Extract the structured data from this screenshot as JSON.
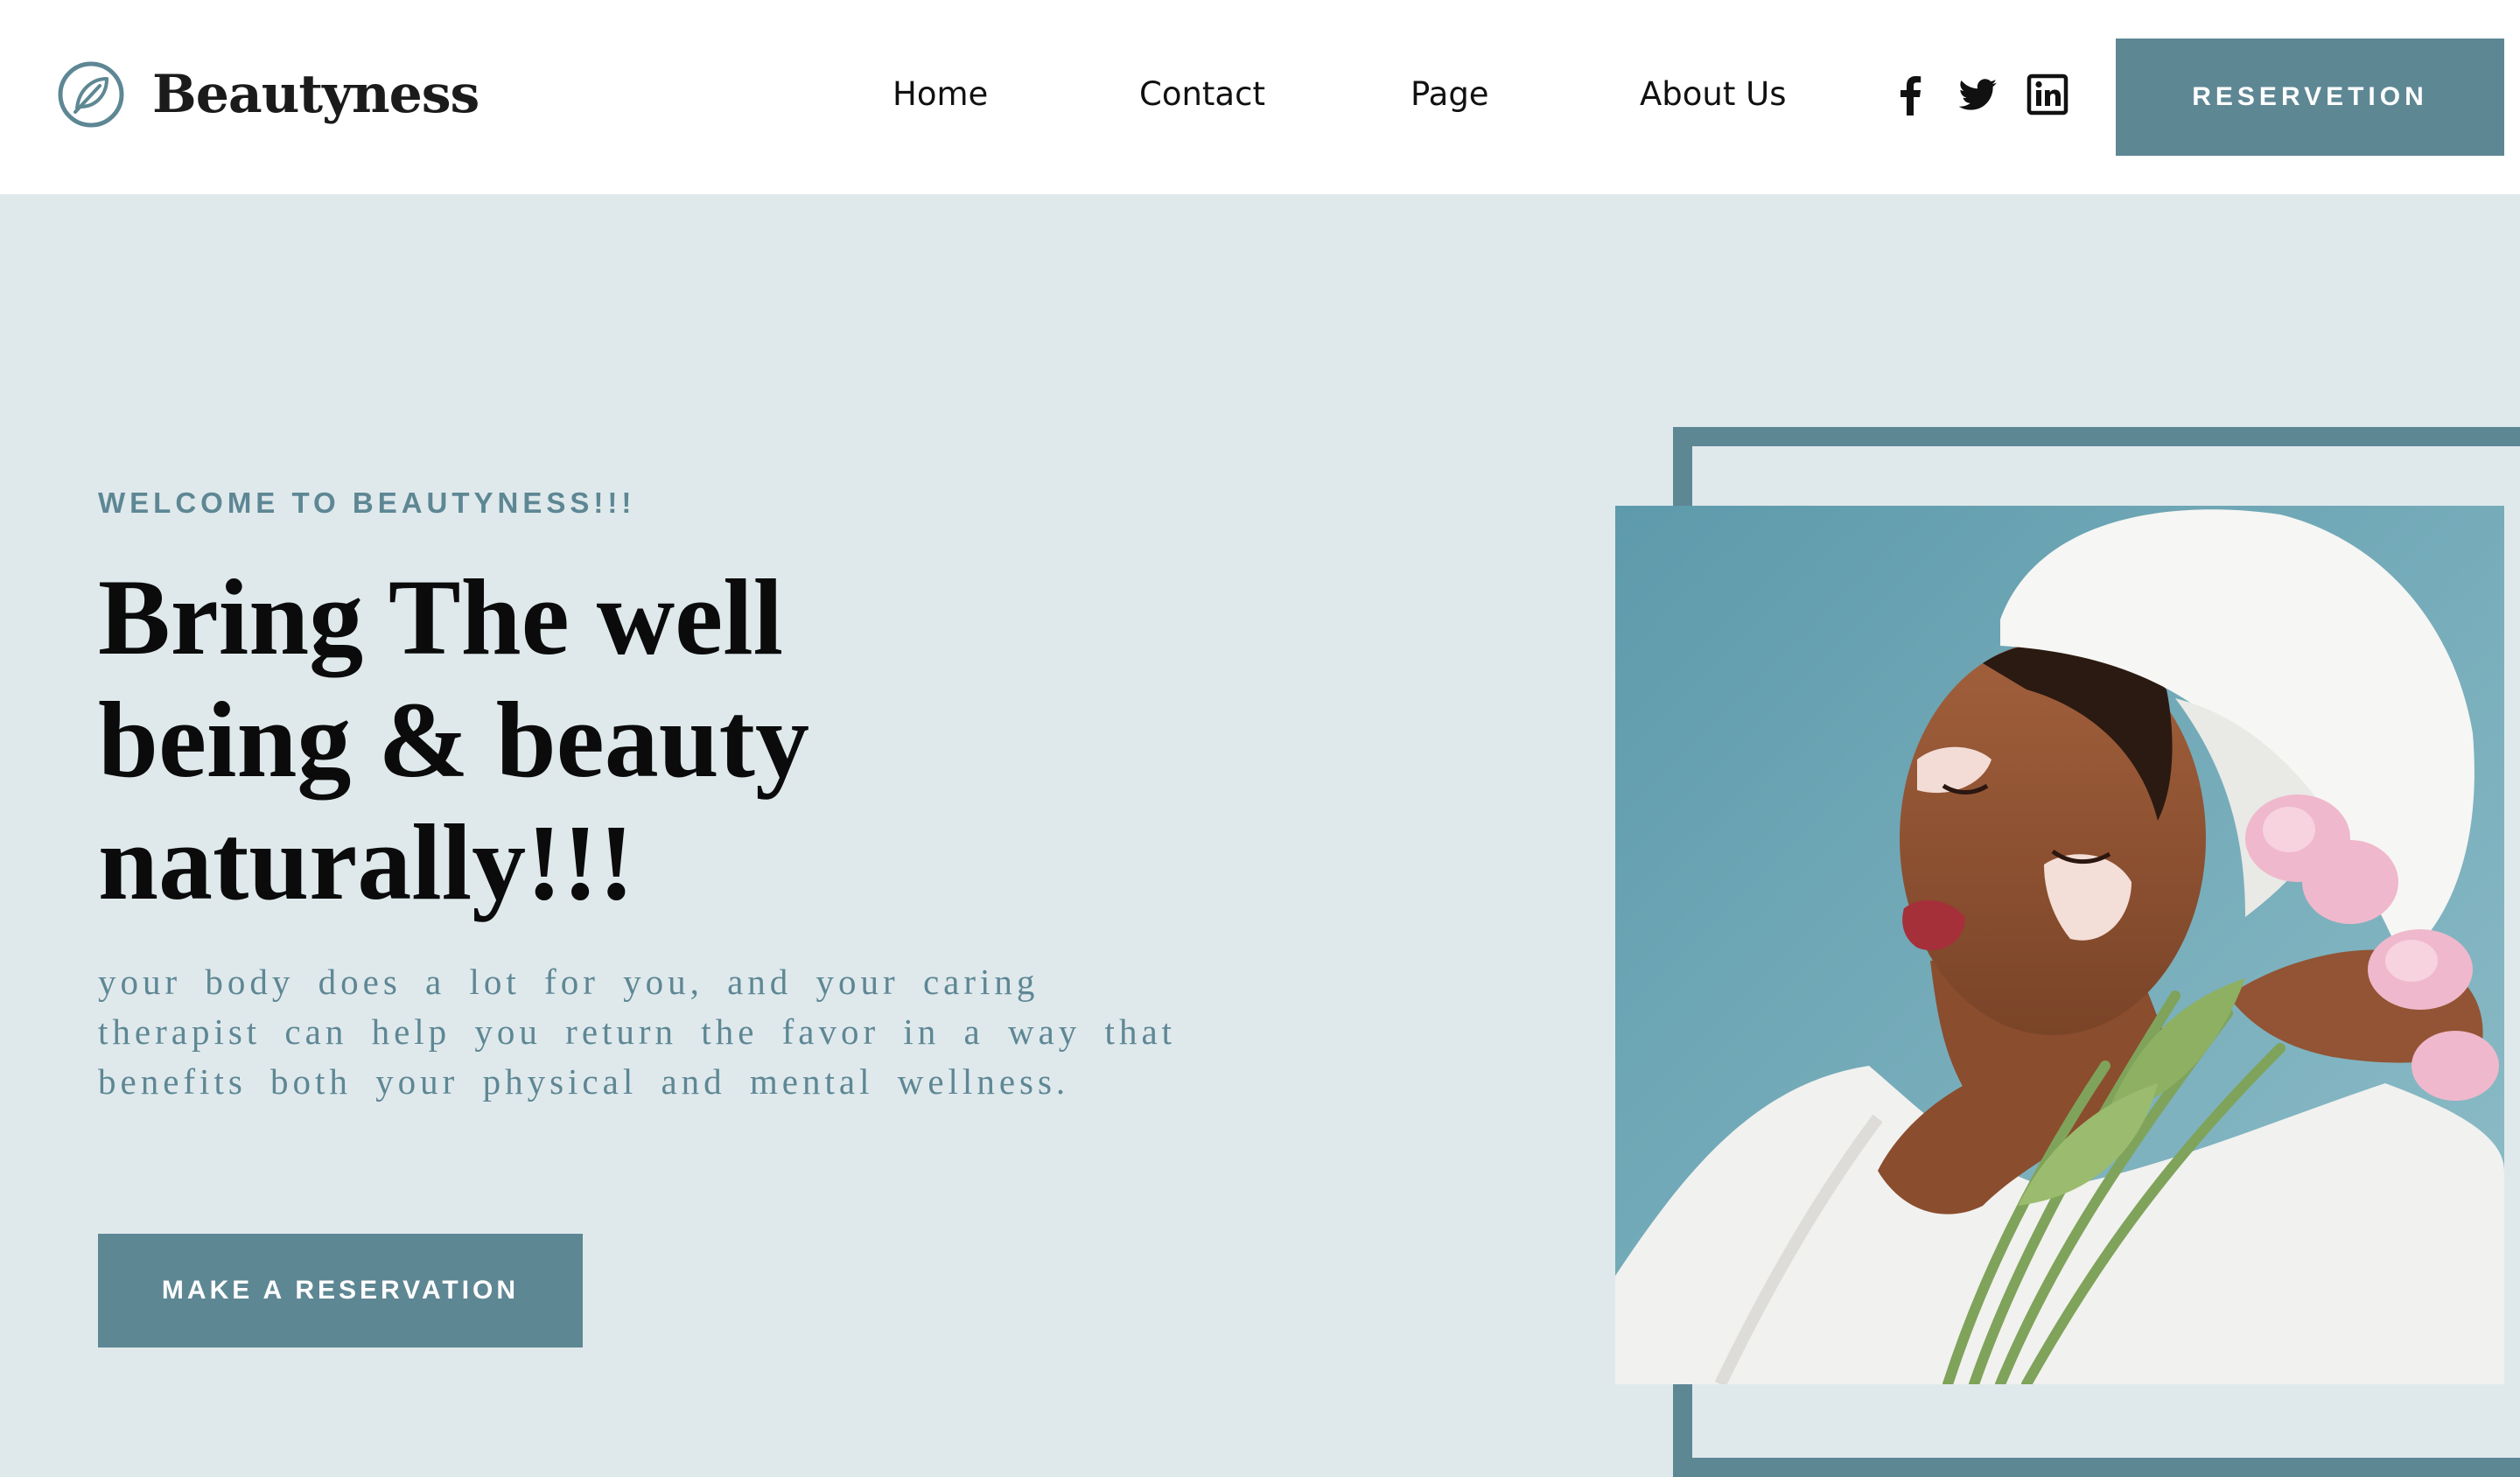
{
  "brand": {
    "name": "Beautyness",
    "logo_icon": "leaf-circle-icon"
  },
  "nav": {
    "items": [
      "Home",
      "Contact",
      "Page",
      "About Us"
    ]
  },
  "social": {
    "icons": [
      "facebook-icon",
      "twitter-icon",
      "linkedin-icon"
    ]
  },
  "header": {
    "reservation_label": "RESERVETION"
  },
  "hero": {
    "eyebrow": "WELCOME TO BEAUTYNESS!!!",
    "headline_lines": [
      "Bring The well",
      "being & beauty",
      "naturally!!!"
    ],
    "description_lines": [
      "your body does a lot for you, and your caring",
      "therapist can help you return the favor in a way that",
      "benefits both your physical and mental wellness."
    ],
    "cta_label": "MAKE A RESERVATION"
  },
  "colors": {
    "accent": "#5e8794",
    "background": "#dfe9ec",
    "header_bg": "#ffffff",
    "text_dark": "#0b0b0b"
  }
}
